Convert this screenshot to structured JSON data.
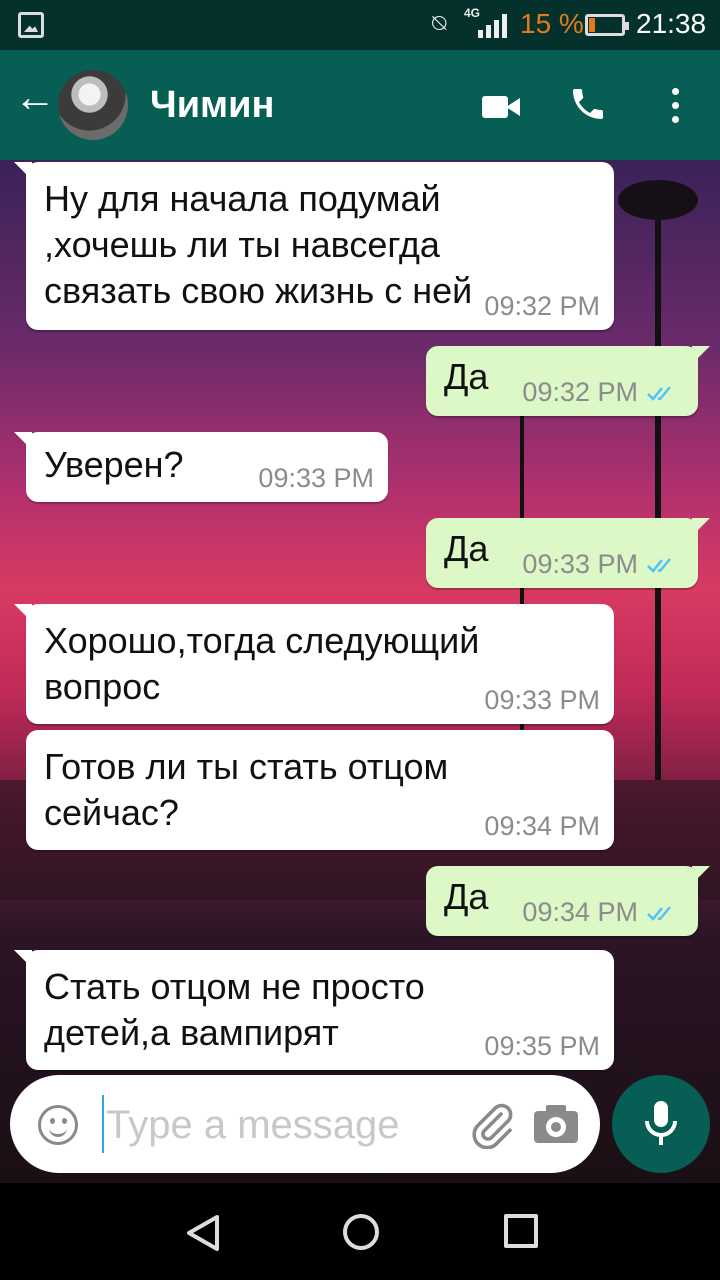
{
  "status_bar": {
    "network": "4G",
    "battery_percent": "15 %",
    "battery_level": 0.15,
    "time": "21:38"
  },
  "header": {
    "back_icon": "arrow-left-icon",
    "contact_name": "Чимин",
    "actions": [
      "video-call-icon",
      "phone-icon",
      "more-vert-icon"
    ]
  },
  "messages": [
    {
      "direction": "in",
      "text": "Ну для начала подумай\n,хочешь ли ты навсегда\nсвязать свою жизнь с ней",
      "time": "09:32 PM"
    },
    {
      "direction": "out",
      "text": "Да",
      "time": "09:32 PM",
      "read": true
    },
    {
      "direction": "in",
      "text": "Уверен?",
      "time": "09:33 PM"
    },
    {
      "direction": "out",
      "text": "Да",
      "time": "09:33 PM",
      "read": true
    },
    {
      "direction": "in",
      "text": "Хорошо,тогда следующий\nвопрос",
      "time": "09:33 PM"
    },
    {
      "direction": "in",
      "text": "Готов ли ты стать отцом\nсейчас?",
      "time": "09:34 PM"
    },
    {
      "direction": "out",
      "text": "Да",
      "time": "09:34 PM",
      "read": true
    },
    {
      "direction": "in",
      "text": "Стать отцом не просто\nдетей,а вампирят",
      "time": "09:35 PM"
    }
  ],
  "composer": {
    "placeholder": "Type a message",
    "value": ""
  },
  "colors": {
    "header": "#075e54",
    "status_bar": "#04312b",
    "outgoing_bubble": "#dcf8c6",
    "incoming_bubble": "#ffffff",
    "read_ticks": "#4fc3f7",
    "battery_low": "#e07a1a"
  }
}
